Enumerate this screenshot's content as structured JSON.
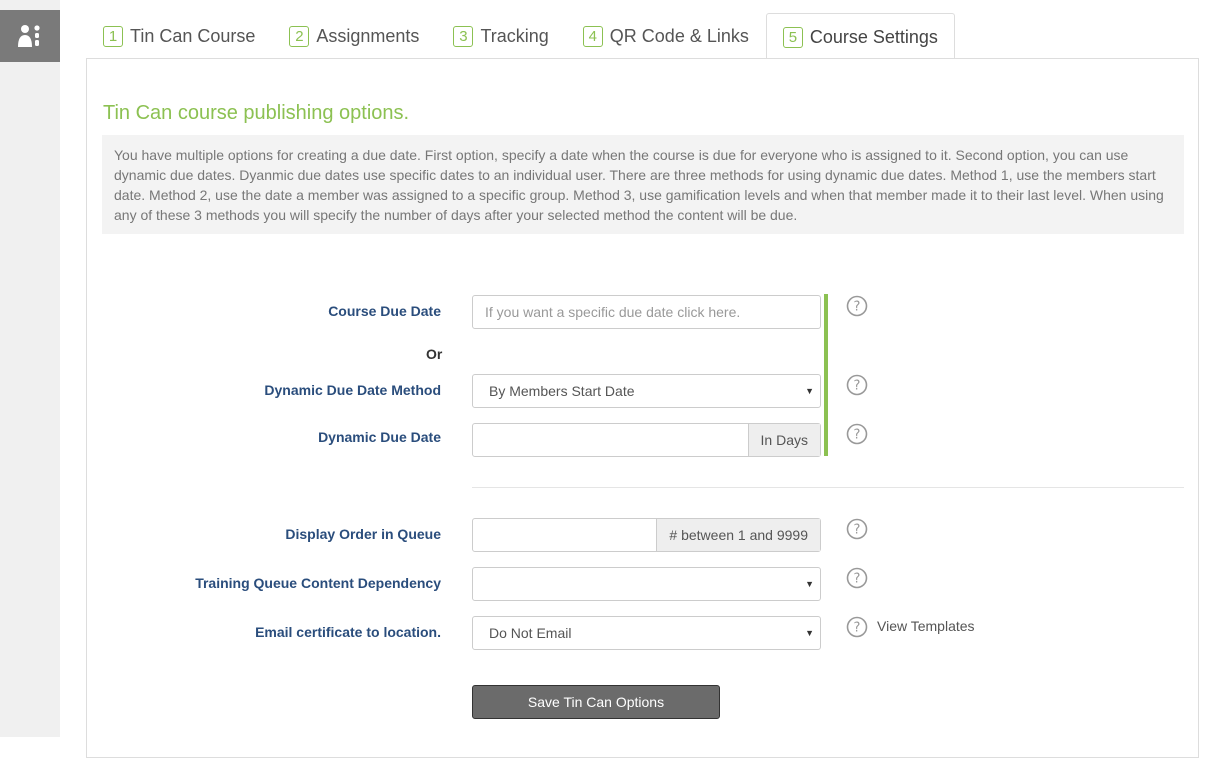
{
  "tabs": [
    {
      "num": "1",
      "label": "Tin Can Course"
    },
    {
      "num": "2",
      "label": "Assignments"
    },
    {
      "num": "3",
      "label": "Tracking"
    },
    {
      "num": "4",
      "label": "QR Code & Links"
    },
    {
      "num": "5",
      "label": "Course Settings"
    }
  ],
  "active_tab": "Course Settings",
  "heading": "Tin Can course publishing options.",
  "info_text": "You have multiple options for creating a due date. First option, specify a date when the course is due for everyone who is assigned to it. Second option, you can use dynamic due dates. Dyanmic due dates use specific dates to an individual user. There are three methods for using dynamic due dates. Method 1, use the members start date. Method 2, use the date a member was assigned to a specific group. Method 3, use gamification levels and when that member made it to their last level. When using any of these 3 methods you will specify the number of days after your selected method the content will be due.",
  "form": {
    "course_due_date": {
      "label": "Course Due Date",
      "placeholder": "If you want a specific due date click here.",
      "value": ""
    },
    "or_label": "Or",
    "dynamic_method": {
      "label": "Dynamic Due Date Method",
      "selected": "By Members Start Date"
    },
    "dynamic_due_date": {
      "label": "Dynamic Due Date",
      "value": "",
      "addon": "In Days"
    },
    "display_order": {
      "label": "Display Order in Queue",
      "value": "",
      "addon": "# between 1 and 9999"
    },
    "dependency": {
      "label": "Training Queue Content Dependency",
      "selected": ""
    },
    "email_certificate": {
      "label": "Email certificate to location.",
      "selected": "Do Not Email"
    },
    "view_templates": "View Templates",
    "save_label": "Save Tin Can Options"
  },
  "colors": {
    "accent": "#8cc152",
    "label": "#2a4d7c",
    "button": "#6b6b6b"
  },
  "icons": {
    "rail": "users-icon",
    "help": "question-circle-icon",
    "caret": "caret-down-icon"
  }
}
